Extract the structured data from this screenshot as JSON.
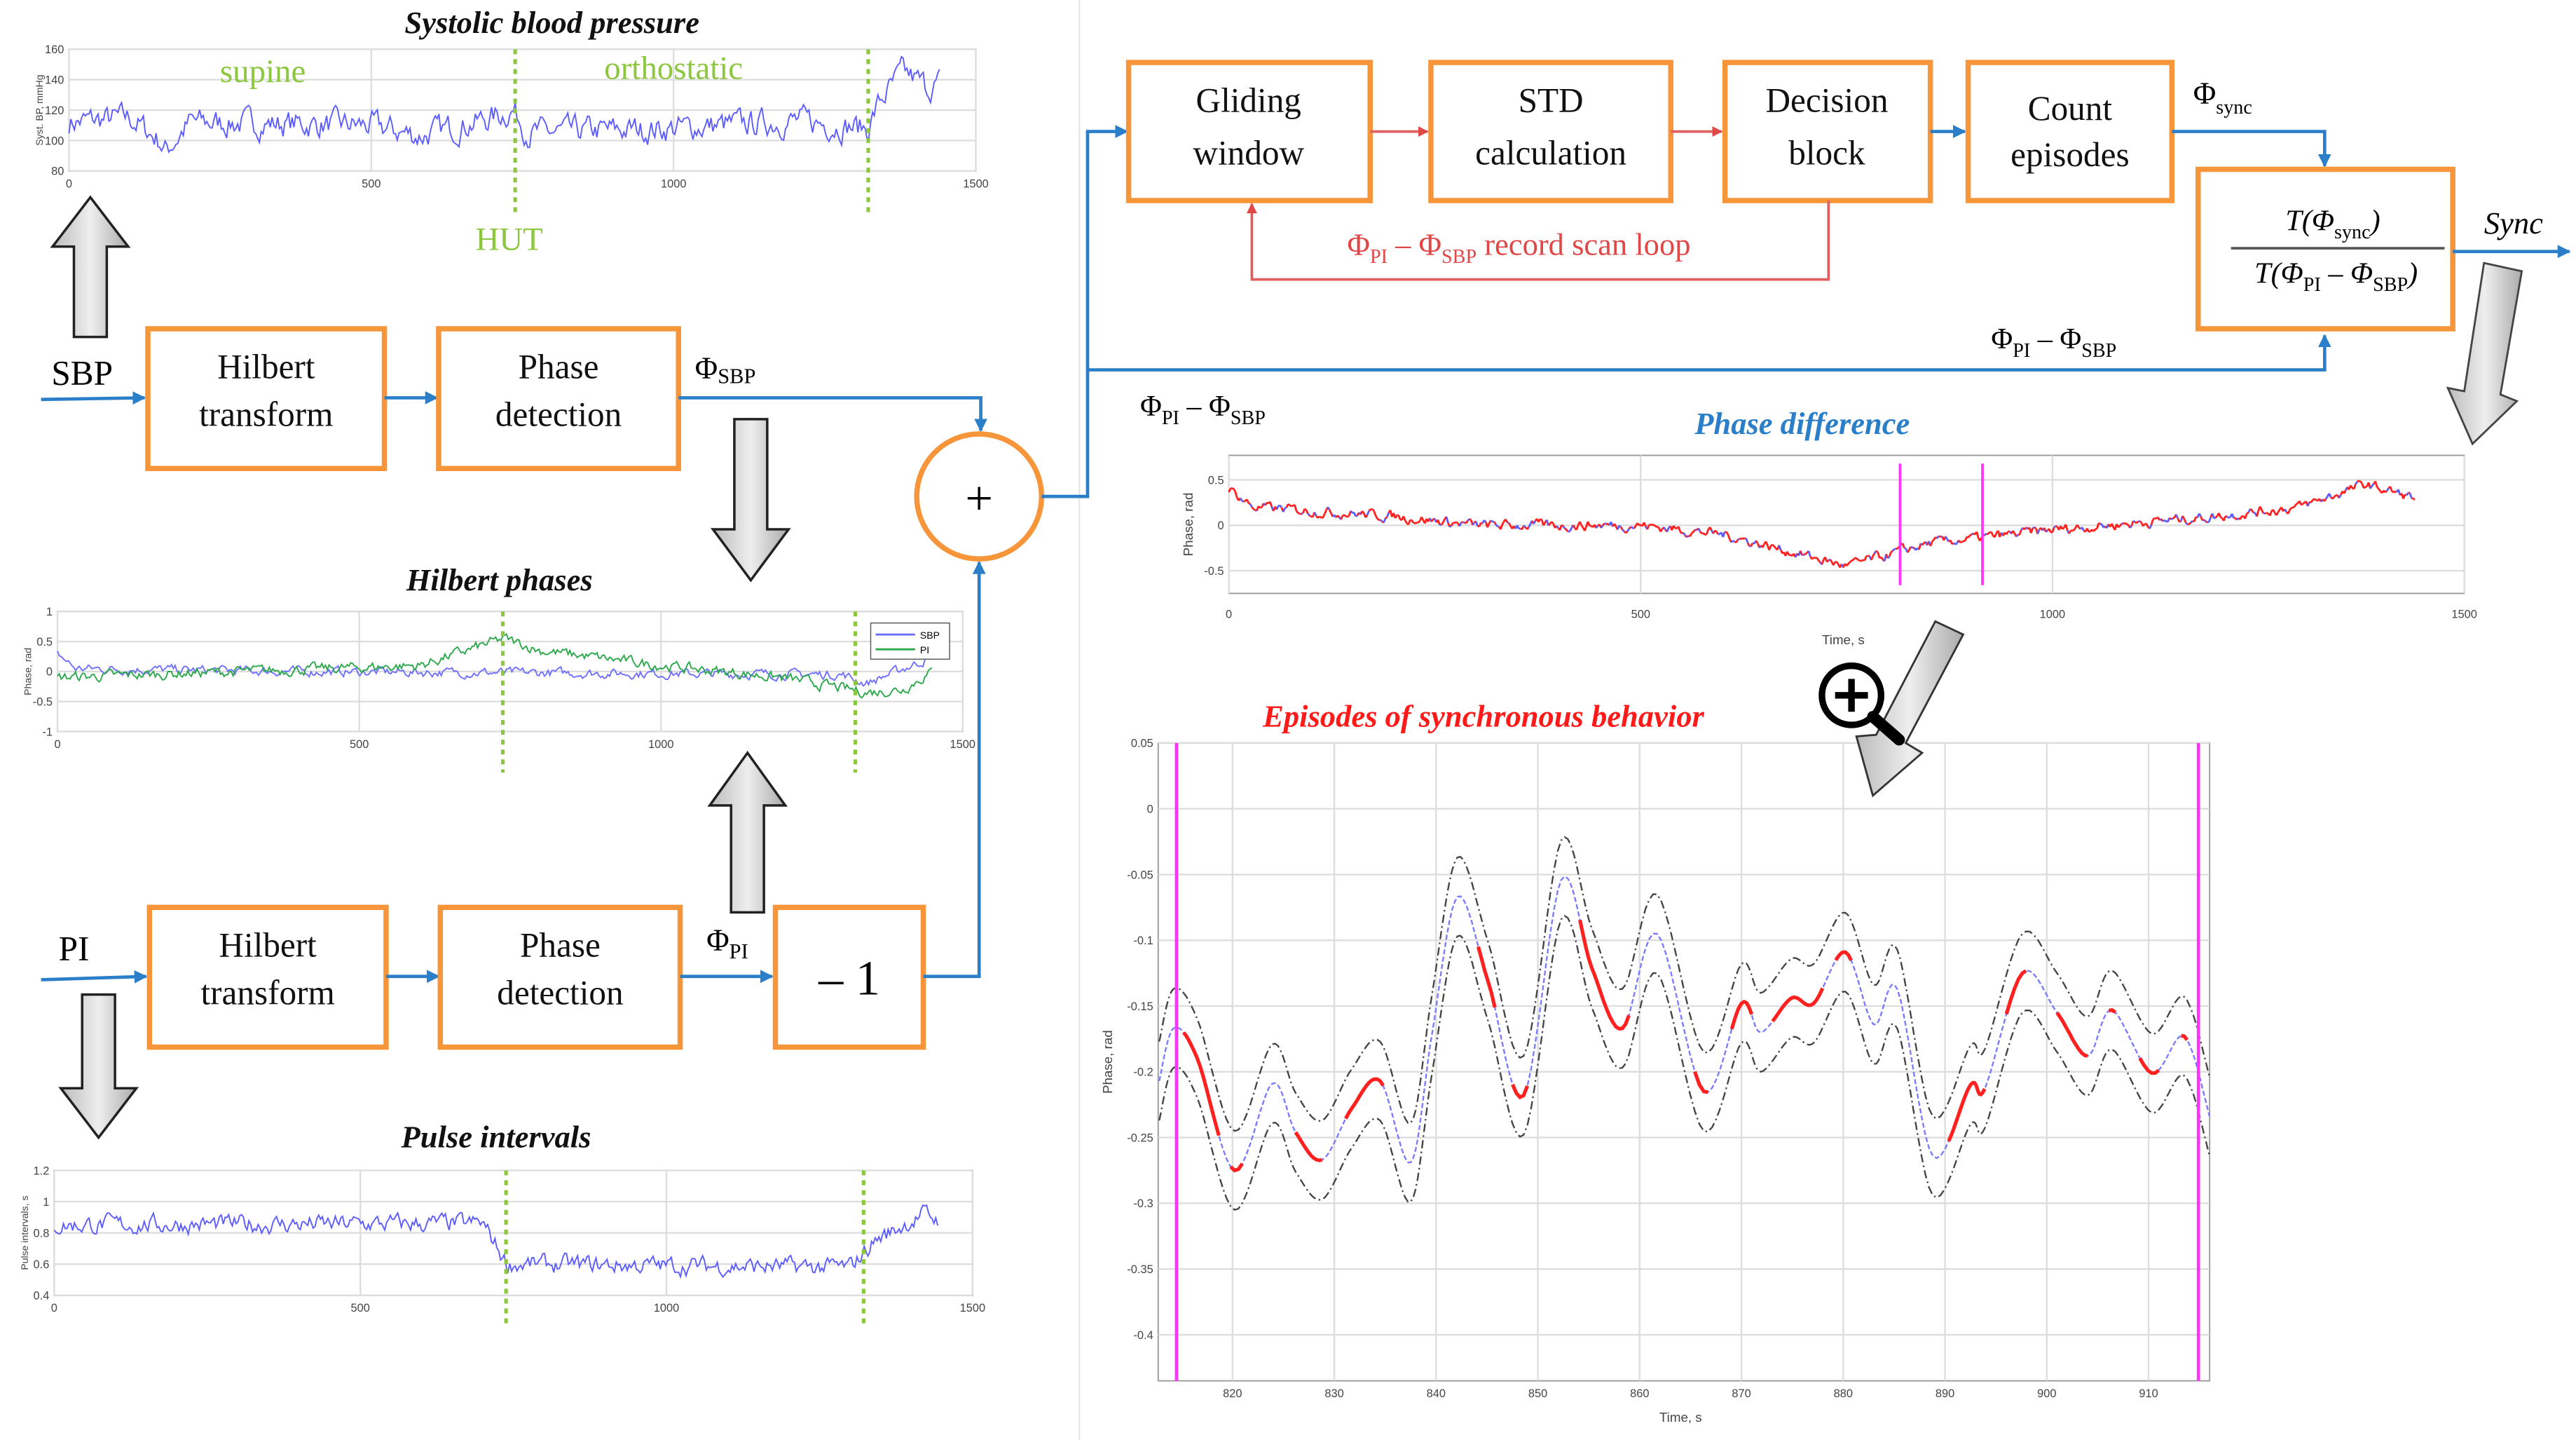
{
  "colors": {
    "box_border": "#f7953b",
    "signal_flow": "#2a7fc8",
    "loop": "#e06060",
    "marker_green": "#8dc63f",
    "marker_magenta": "#ff33ff",
    "sbp_trace": "#5b5bff",
    "pi_trace": "#2aa84a",
    "sync_trace": "#ff2020"
  },
  "left": {
    "sbp_input": "SBP",
    "pi_input": "PI",
    "hilbert_1": [
      "Hilbert",
      "transform"
    ],
    "phase_1": [
      "Phase",
      "detection"
    ],
    "hilbert_2": [
      "Hilbert",
      "transform"
    ],
    "phase_2": [
      "Phase",
      "detection"
    ],
    "phi_sbp": {
      "base": "Φ",
      "sub": "SBP"
    },
    "phi_pi": {
      "base": "Φ",
      "sub": "PI"
    },
    "invert_block": "– 1",
    "sum_symbol": "+"
  },
  "right": {
    "gliding": [
      "Gliding",
      "window"
    ],
    "std": [
      "STD",
      "calculation"
    ],
    "decision": [
      "Decision",
      "block"
    ],
    "count": [
      "Count",
      "episodes"
    ],
    "phi_sync": {
      "base": "Φ",
      "sub": "sync"
    },
    "loop_label": {
      "a": "Φ",
      "a_sub": "PI",
      "dash": " – Φ",
      "b_sub": "SBP",
      "rest": " record scan loop"
    },
    "fraction": {
      "num": "T(Φ",
      "num_sub": "sync",
      "num_end": ")",
      "den": "T(Φ",
      "den_sub1": "PI",
      "den_mid": " – Φ",
      "den_sub2": "SBP",
      "den_end": ")"
    },
    "sync_output": "Sync",
    "diff_label": {
      "a": "Φ",
      "a_sub": "PI",
      "mid": " – Φ",
      "b_sub": "SBP"
    },
    "diff_label_2": {
      "a": "Φ",
      "a_sub": "PI",
      "mid": " – Φ",
      "b_sub": "SBP"
    }
  },
  "icons": {
    "zoom": "magnifier-plus-icon",
    "block_arrow": "gray-block-arrow"
  },
  "chart_data": [
    {
      "type": "line",
      "title": "Systolic blood pressure",
      "ylabel": "Syst. BP, mmHg",
      "xlim": [
        0,
        1500
      ],
      "ylim": [
        80,
        160
      ],
      "xticks": [
        0,
        500,
        1000,
        1500
      ],
      "yticks": [
        80,
        100,
        120,
        140,
        160
      ],
      "grid": true,
      "annotations": {
        "supine": "supine",
        "orthostatic": "orthostatic",
        "hut": "HUT"
      },
      "event_markers": [
        738,
        1322
      ],
      "series": [
        {
          "color": "#5b5bff",
          "trend": [
            [
              0,
              112
            ],
            [
              100,
              115
            ],
            [
              150,
              100
            ],
            [
              160,
              93
            ],
            [
              200,
              112
            ],
            [
              500,
              110
            ],
            [
              580,
              103
            ],
            [
              700,
              115
            ],
            [
              735,
              120
            ],
            [
              760,
              105
            ],
            [
              1000,
              108
            ],
            [
              1200,
              113
            ],
            [
              1320,
              108
            ],
            [
              1340,
              125
            ],
            [
              1380,
              145
            ],
            [
              1420,
              135
            ],
            [
              1440,
              138
            ]
          ],
          "noise": 9
        }
      ]
    },
    {
      "type": "line",
      "title": "Hilbert phases",
      "ylabel": "Phase, rad",
      "xlim": [
        0,
        1500
      ],
      "ylim": [
        -1,
        1
      ],
      "xticks": [
        0,
        500,
        1000,
        1500
      ],
      "yticks": [
        -1,
        -0.5,
        0,
        0.5,
        1
      ],
      "grid": true,
      "legend": "top-right",
      "event_markers": [
        738,
        1322
      ],
      "series": [
        {
          "name": "SBP",
          "color": "#6f6fff",
          "trend": [
            [
              0,
              0.3
            ],
            [
              30,
              0.05
            ],
            [
              400,
              0
            ],
            [
              1300,
              -0.05
            ],
            [
              1340,
              -0.2
            ],
            [
              1440,
              0.2
            ]
          ],
          "noise": 0.08
        },
        {
          "name": "PI",
          "color": "#2aa84a",
          "trend": [
            [
              0,
              -0.1
            ],
            [
              300,
              0
            ],
            [
              600,
              0.1
            ],
            [
              740,
              0.55
            ],
            [
              800,
              0.35
            ],
            [
              1000,
              0.1
            ],
            [
              1200,
              -0.1
            ],
            [
              1340,
              -0.35
            ],
            [
              1400,
              -0.3
            ],
            [
              1450,
              0
            ]
          ],
          "noise": 0.09
        }
      ]
    },
    {
      "type": "line",
      "title": "Pulse intervals",
      "ylabel": "Pulse intervals, s",
      "xlim": [
        0,
        1500
      ],
      "ylim": [
        0.4,
        1.2
      ],
      "xticks": [
        0,
        500,
        1000,
        1500
      ],
      "yticks": [
        0.4,
        0.6,
        0.8,
        1,
        1.2
      ],
      "grid": true,
      "event_markers": [
        738,
        1322
      ],
      "series": [
        {
          "color": "#5b5bff",
          "trend": [
            [
              0,
              0.85
            ],
            [
              700,
              0.86
            ],
            [
              740,
              0.6
            ],
            [
              1300,
              0.58
            ],
            [
              1340,
              0.75
            ],
            [
              1420,
              0.92
            ],
            [
              1445,
              0.88
            ]
          ],
          "noise": 0.06
        }
      ]
    },
    {
      "type": "line",
      "title": "Phase difference",
      "ylabel": "Phase, rad",
      "xlabel": "Time, s",
      "xlim": [
        0,
        1500
      ],
      "ylim": [
        -0.75,
        0.77
      ],
      "xticks": [
        0,
        500,
        1000,
        1500
      ],
      "yticks": [
        -0.5,
        0,
        0.5
      ],
      "grid": true,
      "window_markers": [
        815,
        915
      ],
      "series": [
        {
          "color": "#ff2020",
          "alt_color": "#5b5bff",
          "trend": [
            [
              0,
              0.4
            ],
            [
              30,
              0.2
            ],
            [
              200,
              0.1
            ],
            [
              300,
              0
            ],
            [
              500,
              0
            ],
            [
              600,
              -0.1
            ],
            [
              750,
              -0.45
            ],
            [
              850,
              -0.2
            ],
            [
              1000,
              -0.05
            ],
            [
              1200,
              0.1
            ],
            [
              1300,
              0.2
            ],
            [
              1380,
              0.45
            ],
            [
              1440,
              0.3
            ]
          ],
          "noise": 0.06
        }
      ]
    },
    {
      "type": "line",
      "title": "Episodes of synchronous behavior",
      "ylabel": "Phase, rad",
      "xlabel": "Time, s",
      "xlim": [
        812.7,
        916
      ],
      "ylim": [
        -0.435,
        0.05
      ],
      "xticks": [
        820,
        830,
        840,
        850,
        860,
        870,
        880,
        890,
        900,
        910
      ],
      "yticks": [
        0.05,
        0,
        -0.05,
        -0.1,
        -0.15,
        -0.2,
        -0.25,
        -0.3,
        -0.35,
        -0.4
      ],
      "grid": true,
      "window_markers": [
        814.5,
        914.9
      ],
      "std_band": 0.03,
      "series": [
        {
          "color": "#7a7aff",
          "points": [
            [
              812.8,
              -0.207
            ],
            [
              814.2,
              -0.167
            ],
            [
              816.5,
              -0.189
            ],
            [
              820.2,
              -0.275
            ],
            [
              823.9,
              -0.209
            ],
            [
              826.2,
              -0.246
            ],
            [
              828.8,
              -0.267
            ],
            [
              831.7,
              -0.228
            ],
            [
              834.5,
              -0.207
            ],
            [
              837.5,
              -0.269
            ],
            [
              839.6,
              -0.171
            ],
            [
              842.1,
              -0.067
            ],
            [
              845.1,
              -0.131
            ],
            [
              848.6,
              -0.218
            ],
            [
              852.3,
              -0.054
            ],
            [
              855.3,
              -0.121
            ],
            [
              858.3,
              -0.167
            ],
            [
              861.7,
              -0.095
            ],
            [
              866.3,
              -0.215
            ],
            [
              870.0,
              -0.148
            ],
            [
              871.9,
              -0.17
            ],
            [
              874.9,
              -0.144
            ],
            [
              877.1,
              -0.148
            ],
            [
              880.2,
              -0.109
            ],
            [
              883.0,
              -0.164
            ],
            [
              885.3,
              -0.137
            ],
            [
              888.8,
              -0.264
            ],
            [
              892.5,
              -0.21
            ],
            [
              893.9,
              -0.213
            ],
            [
              897.6,
              -0.125
            ],
            [
              901.0,
              -0.155
            ],
            [
              904.0,
              -0.188
            ],
            [
              906.4,
              -0.153
            ],
            [
              910.3,
              -0.201
            ],
            [
              913.5,
              -0.173
            ],
            [
              916,
              -0.234
            ]
          ]
        }
      ],
      "sync_intervals": [
        [
          815,
          819
        ],
        [
          819.5,
          821
        ],
        [
          826,
          829
        ],
        [
          831,
          835
        ],
        [
          844,
          846
        ],
        [
          847.5,
          849
        ],
        [
          854,
          859
        ],
        [
          865,
          867
        ],
        [
          869,
          871
        ],
        [
          873,
          878
        ],
        [
          879,
          881
        ],
        [
          890,
          894
        ],
        [
          896,
          898
        ],
        [
          901,
          904
        ],
        [
          906,
          907
        ],
        [
          909,
          911
        ],
        [
          913,
          914
        ]
      ]
    }
  ]
}
